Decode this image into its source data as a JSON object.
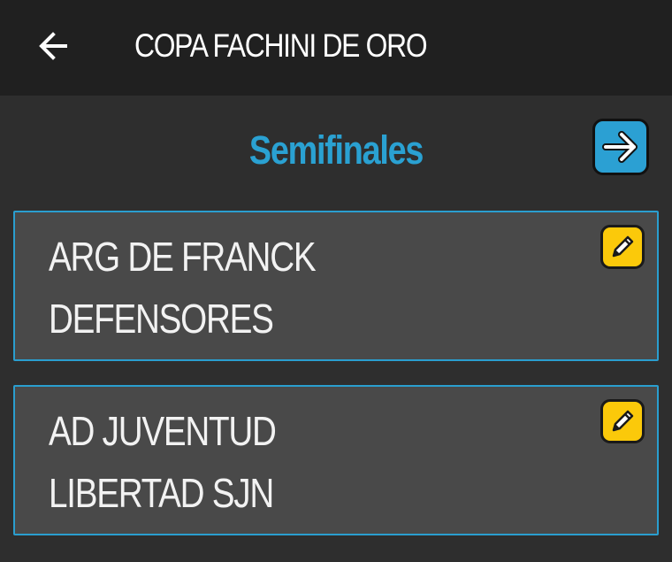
{
  "appbar": {
    "back_icon": "arrow-left-icon",
    "title": "COPA FACHINI DE ORO"
  },
  "round": {
    "title": "Semifinales",
    "next_icon": "arrow-right-icon",
    "next_color": "#2ba0d3"
  },
  "matches": [
    {
      "home": "ARG DE FRANCK",
      "away": "DEFENSORES",
      "edit_icon": "pencil-icon"
    },
    {
      "home": "AD JUVENTUD",
      "away": "LIBERTAD SJN",
      "edit_icon": "pencil-icon"
    }
  ],
  "colors": {
    "accent": "#2aa1d2",
    "edit_button": "#fbc90a",
    "card_bg": "#494949",
    "appbar_bg": "#202020",
    "page_bg": "#2e2e2e"
  }
}
